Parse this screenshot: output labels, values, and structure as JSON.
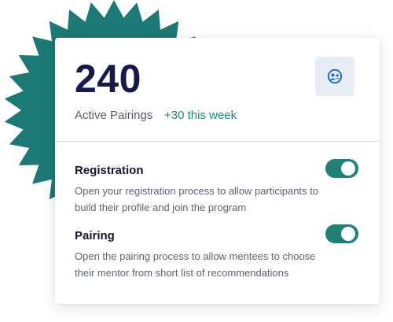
{
  "stats": {
    "value": "240",
    "label": "Active Pairings",
    "delta": "+30 this week",
    "icon": "people-group-icon"
  },
  "settings": [
    {
      "title": "Registration",
      "description": "Open your registration process to allow participants to build their profile and join the program",
      "enabled": true
    },
    {
      "title": "Pairing",
      "description": "Open the pairing process to allow mentees to choose their mentor from short list of recommendations",
      "enabled": true
    }
  ],
  "colors": {
    "accent": "#1f8279",
    "starburst": "#1b7a76",
    "value_text": "#17194a",
    "icon": "#1a6fd6"
  }
}
